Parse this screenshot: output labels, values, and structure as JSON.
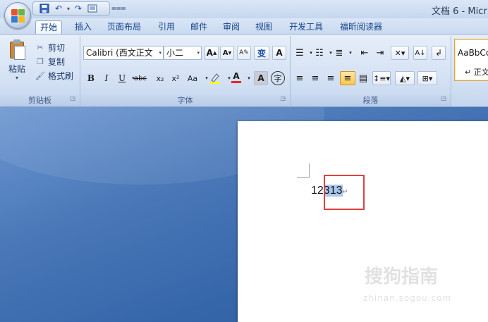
{
  "window": {
    "title": "文档 6 - Micr"
  },
  "tabs": [
    {
      "label": "开始"
    },
    {
      "label": "插入"
    },
    {
      "label": "页面布局"
    },
    {
      "label": "引用"
    },
    {
      "label": "邮件"
    },
    {
      "label": "审阅"
    },
    {
      "label": "视图"
    },
    {
      "label": "开发工具"
    },
    {
      "label": "福昕阅读器"
    }
  ],
  "clipboard": {
    "paste": "粘贴",
    "cut": "剪切",
    "copy": "复制",
    "format_painter": "格式刷",
    "group_label": "剪贴板"
  },
  "font": {
    "font_name": "Calibri (西文正文",
    "font_size": "小二",
    "group_label": "字体",
    "bold": "B",
    "italic": "I",
    "underline": "U",
    "strike": "abc",
    "subscript": "x₂",
    "superscript": "x²",
    "change_case": "Aa",
    "grow": "A",
    "shrink": "A",
    "font_color": "A",
    "char_shading": "A",
    "enclose": "字"
  },
  "paragraph": {
    "group_label": "段落"
  },
  "styles": {
    "sample": "AaBbCc",
    "name": "↵ 正文"
  },
  "document": {
    "text_plain": "12",
    "text_selected": "313",
    "para_mark": "↵"
  },
  "watermark": {
    "text": "搜狗指南",
    "sub": "zhinan.sogou.com"
  }
}
